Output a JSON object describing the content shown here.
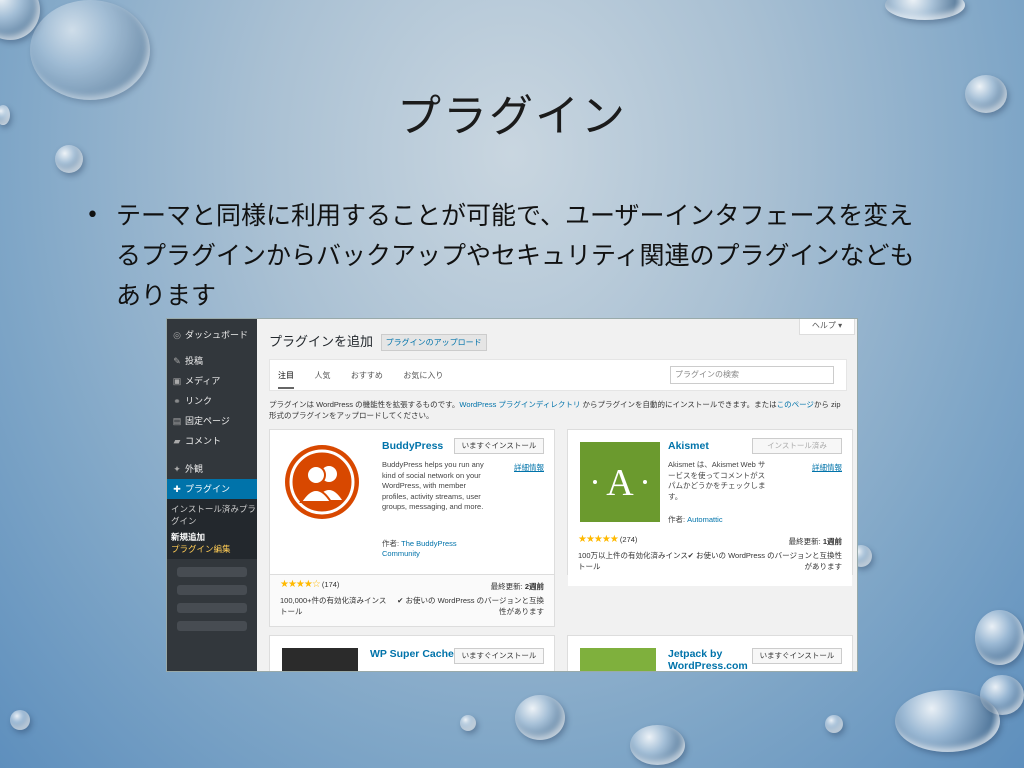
{
  "slide": {
    "title": "プラグイン",
    "bullet": "テーマと同様に利用することが可能で、ユーザーインタフェースを変えるプラグインからバックアップやセキュリティ関連のプラグインなどもあります"
  },
  "sidebar": {
    "items": [
      {
        "icon": "dashboard-icon",
        "glyph": "◎",
        "label": "ダッシュボード"
      },
      {
        "icon": "pin-icon",
        "glyph": "✎",
        "label": "投稿"
      },
      {
        "icon": "media-icon",
        "glyph": "▣",
        "label": "メディア"
      },
      {
        "icon": "link-icon",
        "glyph": "⚭",
        "label": "リンク"
      },
      {
        "icon": "page-icon",
        "glyph": "▤",
        "label": "固定ページ"
      },
      {
        "icon": "comment-icon",
        "glyph": "▰",
        "label": "コメント"
      },
      {
        "icon": "appearance-icon",
        "glyph": "✦",
        "label": "外観"
      },
      {
        "icon": "plugin-icon",
        "glyph": "✚",
        "label": "プラグイン"
      }
    ],
    "submenu": [
      "インストール済みプラグイン",
      "新規追加",
      "プラグイン編集"
    ]
  },
  "main": {
    "help": "ヘルプ ▾",
    "title": "プラグインを追加",
    "upload_label": "プラグインのアップロード",
    "tabs": [
      "注目",
      "人気",
      "おすすめ",
      "お気に入り"
    ],
    "search_placeholder": "プラグインの検索",
    "intro_a": "プラグインは WordPress の機能性を拡張するものです。",
    "intro_link1": "WordPress プラグインディレクトリ",
    "intro_b": " からプラグインを自動的にインストールできます。または",
    "intro_link2": "このページ",
    "intro_c": "から zip 形式のプラグインをアップロードしてください。"
  },
  "cards": [
    {
      "name": "BuddyPress",
      "button": "いますぐインストール",
      "more": "詳細情報",
      "desc": "BuddyPress helps you run any kind of social network on your WordPress, with member profiles, activity streams, user groups, messaging, and more.",
      "author_prefix": "作者: ",
      "author": "The BuddyPress Community",
      "rating": 4,
      "rating_count": "(174)",
      "updated_label": "最終更新: ",
      "updated": "2週前",
      "installs": "100,000+件の有効化済みインストール",
      "compat": "✔ お使いの WordPress のバージョンと互換性があります",
      "accent": "#d84800"
    },
    {
      "name": "Akismet",
      "button": "インストール済み",
      "more": "詳細情報",
      "desc": "Akismet は、Akismet Web サービスを使ってコメントがスパムかどうかをチェックします。",
      "author_prefix": "作者: ",
      "author": "Automattic",
      "rating": 4.5,
      "rating_count": "(274)",
      "updated_label": "最終更新: ",
      "updated": "1週前",
      "installs": "100万以上件の有効化済みインストール",
      "compat": "✔ お使いの WordPress のバージョンと互換性があります",
      "accent": "#6b9a2e"
    },
    {
      "name": "WP Super Cache",
      "button": "いますぐインストール"
    },
    {
      "name": "Jetpack by WordPress.com",
      "button": "いますぐインストール"
    }
  ]
}
